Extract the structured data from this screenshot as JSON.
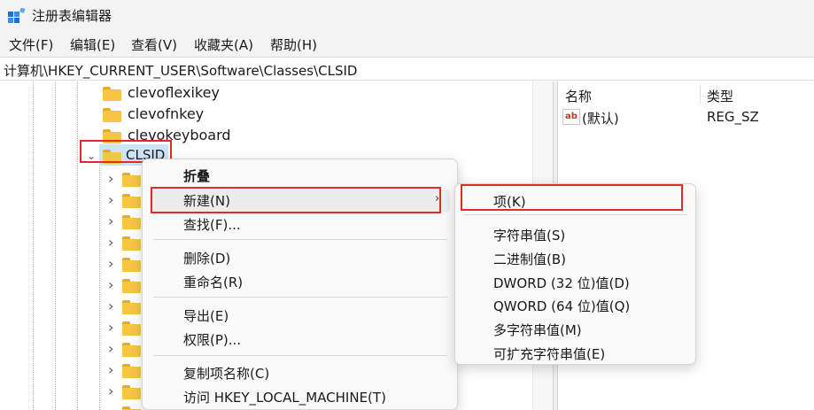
{
  "window": {
    "title": "注册表编辑器",
    "icon": "registry-editor-icon"
  },
  "menubar": {
    "items": [
      "文件(F)",
      "编辑(E)",
      "查看(V)",
      "收藏夹(A)",
      "帮助(H)"
    ]
  },
  "address": {
    "path": "计算机\\HKEY_CURRENT_USER\\Software\\Classes\\CLSID"
  },
  "tree": {
    "items": [
      {
        "label": "clevoflexikey"
      },
      {
        "label": "clevofnkey"
      },
      {
        "label": "clevokeyboard"
      },
      {
        "label": "CLSID",
        "expanded": true,
        "selected": true
      }
    ]
  },
  "values_pane": {
    "headers": {
      "name": "名称",
      "type": "类型"
    },
    "rows": [
      {
        "icon": "string-value-icon",
        "name": "(默认)",
        "type": "REG_SZ"
      }
    ]
  },
  "context_menu": {
    "items": [
      {
        "label": "折叠",
        "bold": true
      },
      {
        "label": "新建(N)",
        "highlighted": true,
        "submenu_arrow": "›"
      },
      {
        "label": "查找(F)..."
      },
      {
        "label": "删除(D)"
      },
      {
        "label": "重命名(R)"
      },
      {
        "label": "导出(E)"
      },
      {
        "label": "权限(P)..."
      },
      {
        "label": "复制项名称(C)"
      },
      {
        "label": "访问 HKEY_LOCAL_MACHINE(T)"
      }
    ]
  },
  "submenu": {
    "items": [
      {
        "label": "项(K)"
      },
      {
        "label": "字符串值(S)"
      },
      {
        "label": "二进制值(B)"
      },
      {
        "label": "DWORD (32 位)值(D)"
      },
      {
        "label": "QWORD (64 位)值(Q)"
      },
      {
        "label": "多字符串值(M)"
      },
      {
        "label": "可扩充字符串值(E)"
      }
    ]
  },
  "colors": {
    "highlight_border": "#e12b2b",
    "selection": "#cce4f7",
    "folder": "#f7c543"
  }
}
